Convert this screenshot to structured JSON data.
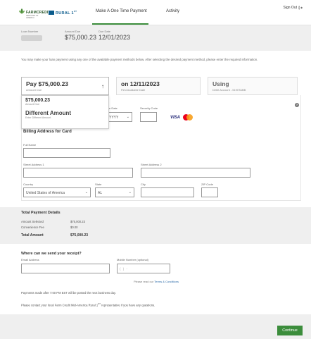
{
  "header": {
    "brand_name": "FARMCREDIT",
    "brand_sub": "SERVICES OF AMERICA",
    "rural_brand": "RURAL 1",
    "rural_sup": "ST",
    "tabs": [
      {
        "label": "Make A One Time Payment",
        "active": true
      },
      {
        "label": "Activity",
        "active": false
      }
    ],
    "sign_out": "Sign Out"
  },
  "loan": {
    "loan_number_label": "Loan Number",
    "amount_due_label": "Amount Due",
    "amount_due": "$75,000.23",
    "due_date_label": "Due Date",
    "due_date": "12/01/2023"
  },
  "intro": "You may make your loan payment using any one of the available payment methods below. After selecting the desired payment method, please enter the required information.",
  "cards": {
    "amount": {
      "title": "Pay $75,000.23",
      "sub": "Amount Due"
    },
    "date": {
      "title": "on 12/11/2023",
      "sub": "First Available Date"
    },
    "method": {
      "title": "Using",
      "sub": "Debit Account - 5190TABB"
    }
  },
  "amount_dropdown": {
    "options": [
      {
        "title": "$75,000.23",
        "sub": "Amount Due"
      },
      {
        "title": "Different Amount",
        "sub": "Enter Different Amount"
      }
    ]
  },
  "card_form": {
    "exp_label": "e Date",
    "exp_year": "YYYY",
    "security_label": "Security Code",
    "visa": "VISA",
    "billing_title": "Billing Address for Card",
    "full_name_label": "Full Name",
    "street1_label": "Street Address 1",
    "street2_label": "Street Address 2",
    "country_label": "Country",
    "country_value": "United States of America",
    "state_label": "State",
    "state_value": "AL",
    "city_label": "City",
    "zip_label": "ZIP Code"
  },
  "totals": {
    "title": "Total Payment Details",
    "amount_selected_label": "Amount Selected",
    "amount_selected": "$75,000.23",
    "fee_label": "Convenience Fee",
    "fee": "$0.00",
    "total_label": "Total Amount",
    "total": "$75,000.23"
  },
  "receipt": {
    "title": "Where can we send your receipt?",
    "email_label": "Email Address",
    "mobile_label": "Mobile Number (optional)",
    "phone_placeholder": "(   )   -",
    "terms_prefix": "Please read our",
    "terms_link": "Terms & Conditions"
  },
  "notes": {
    "cutoff": "Payments made after 7:00 PM EST will be posted the next business day.",
    "contact_a": "Please contact your local Farm Credit Mid-America Rural 1",
    "contact_sup": "ST",
    "contact_b": " representative if you have any questions."
  },
  "footer": {
    "continue": "Continue"
  }
}
